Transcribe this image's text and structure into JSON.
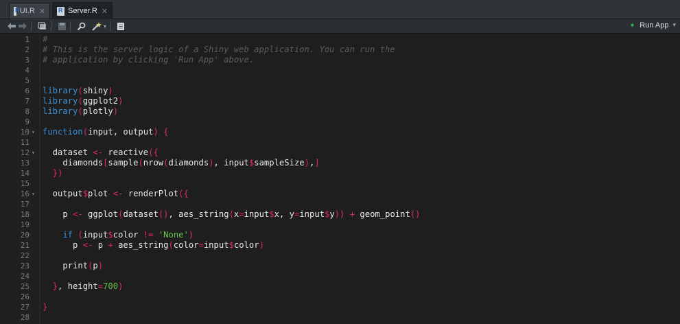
{
  "tabs": [
    {
      "label": "UI.R",
      "active": false
    },
    {
      "label": "Server.R",
      "active": true
    }
  ],
  "toolbar": {
    "run_app_label": "Run App"
  },
  "icons": {
    "file": "r-file-icon",
    "close": "close-icon",
    "back": "back-arrow-icon",
    "forward": "forward-arrow-icon",
    "show_in_window": "show-in-new-window-icon",
    "save": "save-icon",
    "find": "search-icon",
    "code_tools": "magic-wand-icon",
    "compile": "notebook-icon",
    "run": "play-icon"
  },
  "colors": {
    "comment": "#5c5c5c",
    "keyword": "#3d8fd6",
    "operator": "#e5276f",
    "string": "#6cc24a",
    "text": "#e8e8e8",
    "run_icon": "#3bb54a"
  },
  "editor": {
    "lines": [
      {
        "n": "1",
        "fold": false,
        "tokens": [
          [
            "comment",
            "#"
          ]
        ]
      },
      {
        "n": "2",
        "fold": false,
        "tokens": [
          [
            "comment",
            "# This is the server logic of a Shiny web application. You can run the"
          ]
        ]
      },
      {
        "n": "3",
        "fold": false,
        "tokens": [
          [
            "comment",
            "# application by clicking 'Run App' above."
          ]
        ]
      },
      {
        "n": "4",
        "fold": false,
        "tokens": []
      },
      {
        "n": "5",
        "fold": false,
        "tokens": []
      },
      {
        "n": "6",
        "fold": false,
        "tokens": [
          [
            "kw",
            "library"
          ],
          [
            "op",
            "("
          ],
          [
            "plain",
            "shiny"
          ],
          [
            "op",
            ")"
          ]
        ]
      },
      {
        "n": "7",
        "fold": false,
        "tokens": [
          [
            "kw",
            "library"
          ],
          [
            "op",
            "("
          ],
          [
            "plain",
            "ggplot2"
          ],
          [
            "op",
            ")"
          ]
        ]
      },
      {
        "n": "8",
        "fold": false,
        "tokens": [
          [
            "kw",
            "library"
          ],
          [
            "op",
            "("
          ],
          [
            "plain",
            "plotly"
          ],
          [
            "op",
            ")"
          ]
        ]
      },
      {
        "n": "9",
        "fold": false,
        "tokens": []
      },
      {
        "n": "10",
        "fold": true,
        "tokens": [
          [
            "kw",
            "function"
          ],
          [
            "op",
            "("
          ],
          [
            "plain",
            "input, output"
          ],
          [
            "op",
            ")"
          ],
          [
            "plain",
            " "
          ],
          [
            "op",
            "{"
          ]
        ]
      },
      {
        "n": "11",
        "fold": false,
        "tokens": []
      },
      {
        "n": "12",
        "fold": true,
        "tokens": [
          [
            "plain",
            "  dataset "
          ],
          [
            "op",
            "<-"
          ],
          [
            "plain",
            " reactive"
          ],
          [
            "op",
            "({"
          ]
        ]
      },
      {
        "n": "13",
        "fold": false,
        "tokens": [
          [
            "plain",
            "    diamonds"
          ],
          [
            "op",
            "["
          ],
          [
            "plain",
            "sample"
          ],
          [
            "op",
            "("
          ],
          [
            "plain",
            "nrow"
          ],
          [
            "op",
            "("
          ],
          [
            "plain",
            "diamonds"
          ],
          [
            "op",
            ")"
          ],
          [
            "plain",
            ", input"
          ],
          [
            "op",
            "$"
          ],
          [
            "plain",
            "sampleSize"
          ],
          [
            "op",
            ")"
          ],
          [
            "plain",
            ","
          ],
          [
            "op",
            "]"
          ]
        ]
      },
      {
        "n": "14",
        "fold": false,
        "tokens": [
          [
            "op",
            "  })"
          ]
        ]
      },
      {
        "n": "15",
        "fold": false,
        "tokens": []
      },
      {
        "n": "16",
        "fold": true,
        "tokens": [
          [
            "plain",
            "  output"
          ],
          [
            "op",
            "$"
          ],
          [
            "plain",
            "plot "
          ],
          [
            "op",
            "<-"
          ],
          [
            "plain",
            " renderPlot"
          ],
          [
            "op",
            "({"
          ]
        ]
      },
      {
        "n": "17",
        "fold": false,
        "tokens": []
      },
      {
        "n": "18",
        "fold": false,
        "tokens": [
          [
            "plain",
            "    p "
          ],
          [
            "op",
            "<-"
          ],
          [
            "plain",
            " ggplot"
          ],
          [
            "op",
            "("
          ],
          [
            "plain",
            "dataset"
          ],
          [
            "op",
            "()"
          ],
          [
            "plain",
            ", aes_string"
          ],
          [
            "op",
            "("
          ],
          [
            "plain",
            "x"
          ],
          [
            "op",
            "="
          ],
          [
            "plain",
            "input"
          ],
          [
            "op",
            "$"
          ],
          [
            "plain",
            "x, y"
          ],
          [
            "op",
            "="
          ],
          [
            "plain",
            "input"
          ],
          [
            "op",
            "$"
          ],
          [
            "plain",
            "y"
          ],
          [
            "op",
            "))"
          ],
          [
            "plain",
            " "
          ],
          [
            "op",
            "+"
          ],
          [
            "plain",
            " geom_point"
          ],
          [
            "op",
            "()"
          ]
        ]
      },
      {
        "n": "19",
        "fold": false,
        "tokens": []
      },
      {
        "n": "20",
        "fold": false,
        "tokens": [
          [
            "kw",
            "    if"
          ],
          [
            "plain",
            " "
          ],
          [
            "op",
            "("
          ],
          [
            "plain",
            "input"
          ],
          [
            "op",
            "$"
          ],
          [
            "plain",
            "color "
          ],
          [
            "op",
            "!="
          ],
          [
            "plain",
            " "
          ],
          [
            "str",
            "'None'"
          ],
          [
            "op",
            ")"
          ]
        ]
      },
      {
        "n": "21",
        "fold": false,
        "tokens": [
          [
            "plain",
            "      p "
          ],
          [
            "op",
            "<-"
          ],
          [
            "plain",
            " p "
          ],
          [
            "op",
            "+"
          ],
          [
            "plain",
            " aes_string"
          ],
          [
            "op",
            "("
          ],
          [
            "plain",
            "color"
          ],
          [
            "op",
            "="
          ],
          [
            "plain",
            "input"
          ],
          [
            "op",
            "$"
          ],
          [
            "plain",
            "color"
          ],
          [
            "op",
            ")"
          ]
        ]
      },
      {
        "n": "22",
        "fold": false,
        "tokens": []
      },
      {
        "n": "23",
        "fold": false,
        "tokens": [
          [
            "plain",
            "    print"
          ],
          [
            "op",
            "("
          ],
          [
            "plain",
            "p"
          ],
          [
            "op",
            ")"
          ]
        ]
      },
      {
        "n": "24",
        "fold": false,
        "tokens": []
      },
      {
        "n": "25",
        "fold": false,
        "tokens": [
          [
            "op",
            "  }"
          ],
          [
            "plain",
            ", height"
          ],
          [
            "op",
            "="
          ],
          [
            "num",
            "700"
          ],
          [
            "op",
            ")"
          ]
        ]
      },
      {
        "n": "26",
        "fold": false,
        "tokens": []
      },
      {
        "n": "27",
        "fold": false,
        "tokens": [
          [
            "op",
            "}"
          ]
        ]
      },
      {
        "n": "28",
        "fold": false,
        "tokens": []
      }
    ]
  }
}
